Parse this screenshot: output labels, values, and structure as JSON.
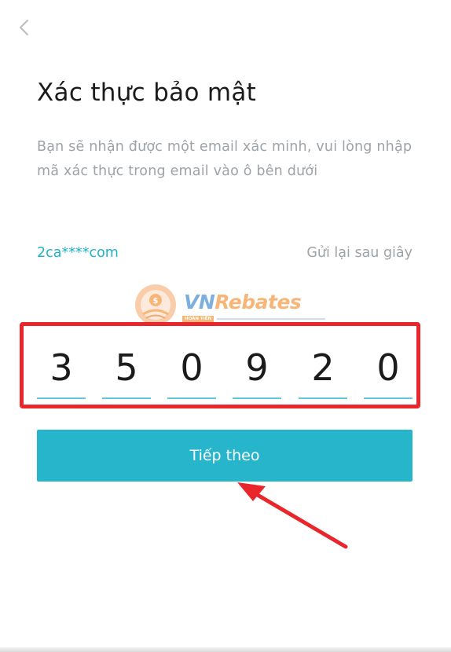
{
  "header": {
    "back_icon": "chevron-left-icon"
  },
  "title": "Xác thực bảo mật",
  "description": "Bạn sẽ nhận được một email xác minh, vui lòng nhập mã xác thực trong email vào ô bên dưới",
  "email": {
    "masked_address": "2ca****com",
    "resend_label": "Gửi lại sau giây"
  },
  "code": {
    "digits": [
      "3",
      "5",
      "0",
      "9",
      "2",
      "0"
    ]
  },
  "next_button": {
    "label": "Tiếp theo"
  },
  "watermark": {
    "brand_vn": "VN",
    "brand_rebates": "Rebates",
    "badge": "HOÀN TIỀN"
  },
  "colors": {
    "accent": "#27b5cb",
    "masked_email": "#1fb3c7",
    "digit_underline": "#5fc8d8",
    "highlight_box": "#e8262b",
    "annotation_arrow": "#e8262b",
    "title_text": "#1b1b1b",
    "secondary_text": "#9ea3a8"
  }
}
